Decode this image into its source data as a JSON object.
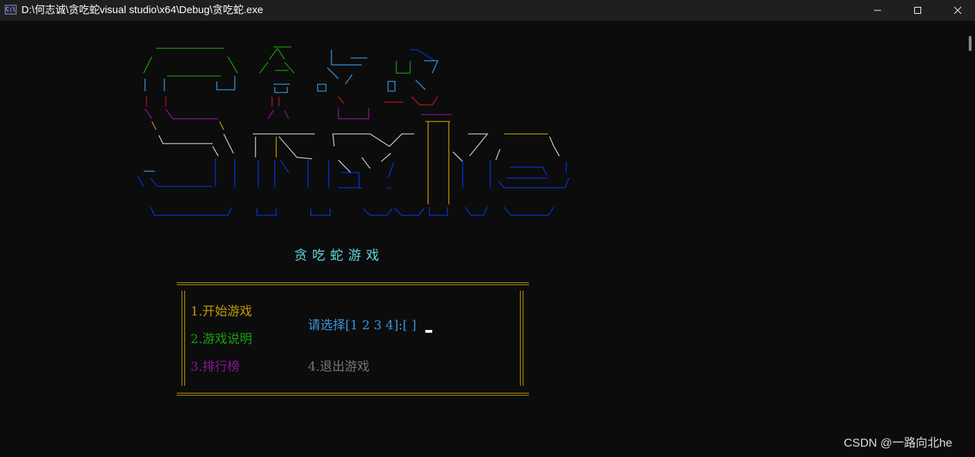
{
  "window": {
    "title": "D:\\何志诚\\贪吃蛇visual studio\\x64\\Debug\\贪吃蛇.exe",
    "icon_label": "C:\\",
    "icons": {
      "app": "console-app-icon",
      "minimize": "minimize-icon",
      "maximize": "maximize-icon",
      "close": "close-icon"
    }
  },
  "logo": {
    "description_icon": "ascii-art-logo",
    "colors": {
      "green": "#13a10e",
      "blue": "#0037da",
      "cyan_blue": "#3a96dd",
      "red": "#c50f1f",
      "purple": "#881798",
      "yellow": "#c19c00",
      "white": "#cccccc"
    }
  },
  "game": {
    "title": "贪吃蛇游戏",
    "menu": {
      "start": "1.开始游戏",
      "instructions": "2.游戏说明",
      "leaderboard": "3.排行榜",
      "exit": "4.退出游戏",
      "prompt": "请选择[1 2 3 4]:[ ]"
    }
  },
  "colors": {
    "background": "#0c0c0c",
    "titlebar": "#1f1f1f",
    "border": "#c19c00",
    "title": "#61d6d6",
    "start": "#c19c00",
    "instructions": "#13a10e",
    "leaderboard": "#881798",
    "exit": "#767676",
    "prompt": "#3a96dd"
  },
  "watermark": "CSDN @一路向北he"
}
